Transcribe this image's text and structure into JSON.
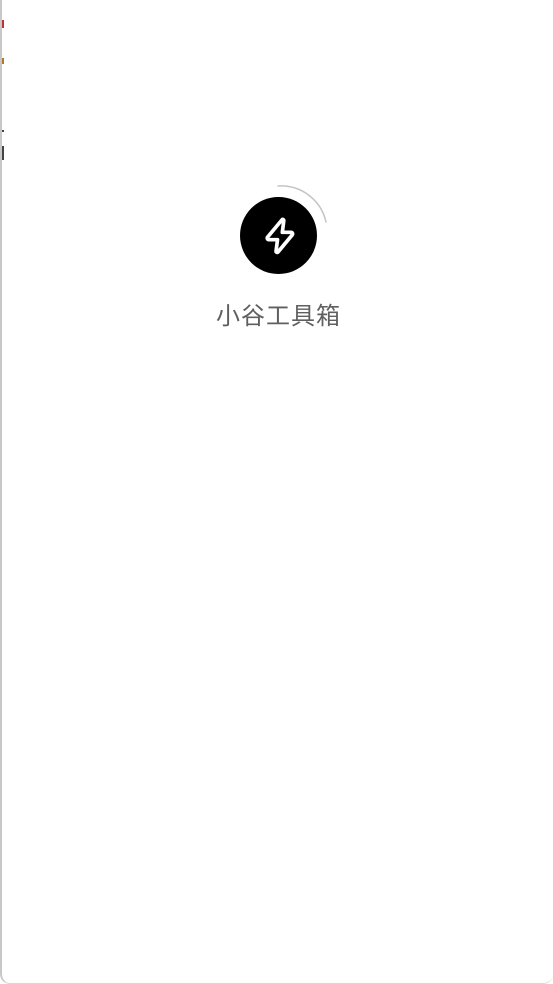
{
  "splash": {
    "app_name": "小谷工具箱",
    "logo_icon": "lightning-bolt-icon",
    "loading_indicator": "spinner-arc"
  },
  "colors": {
    "background": "#ffffff",
    "logo_circle": "#000000",
    "logo_glyph": "#ffffff",
    "app_name_text": "#5f5f5f",
    "spinner_arc": "#c4c4c4"
  }
}
